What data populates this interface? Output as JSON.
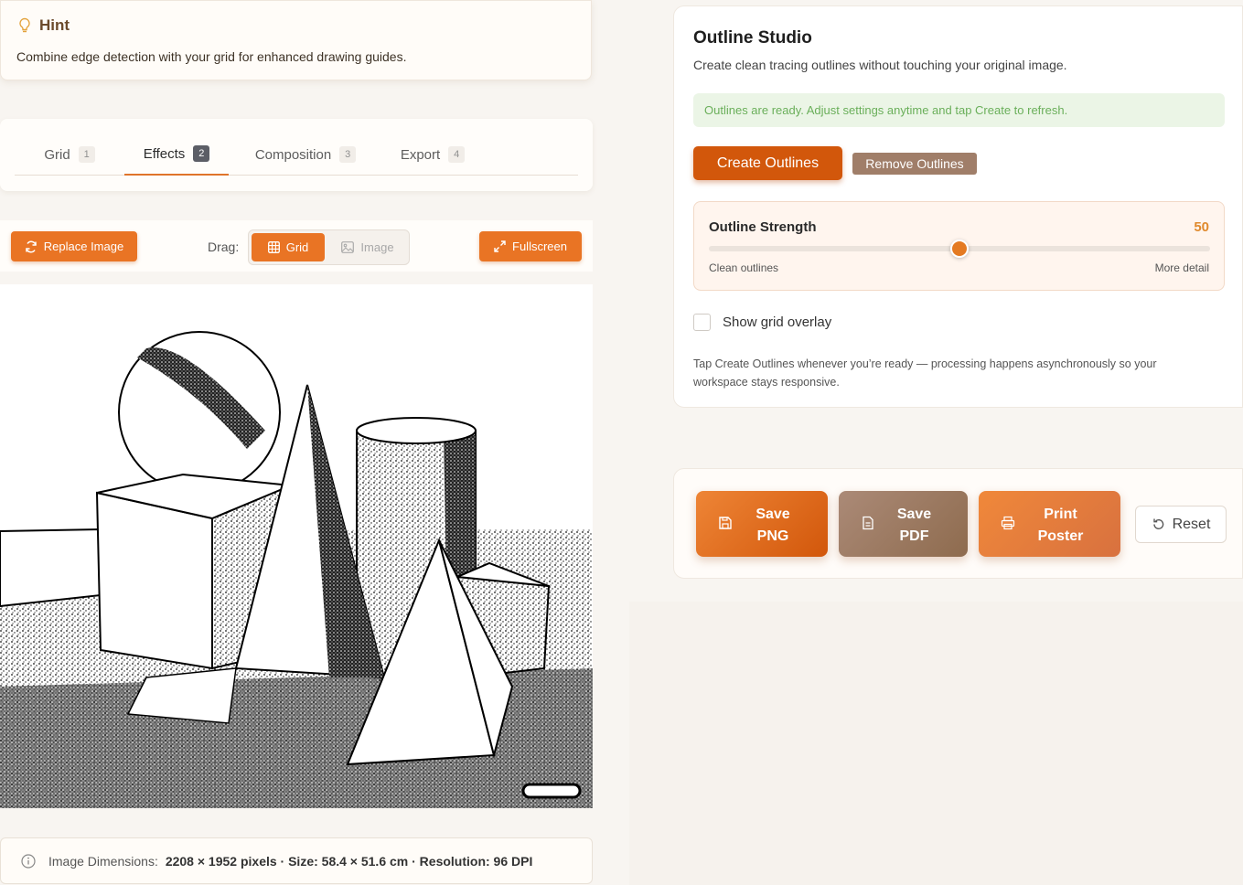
{
  "hint": {
    "title": "Hint",
    "text": "Combine edge detection with your grid for enhanced drawing guides."
  },
  "tabs": [
    {
      "label": "Grid",
      "num": "1"
    },
    {
      "label": "Effects",
      "num": "2"
    },
    {
      "label": "Composition",
      "num": "3"
    },
    {
      "label": "Export",
      "num": "4"
    }
  ],
  "active_tab": "Effects",
  "toolbar": {
    "replace_label": "Replace Image",
    "drag_label": "Drag:",
    "grid_label": "Grid",
    "image_label": "Image",
    "fullscreen_label": "Fullscreen"
  },
  "info": {
    "label": "Image Dimensions:",
    "value": "2208 × 1952 pixels · Size: 58.4 × 51.6 cm · Resolution: 96 DPI"
  },
  "studio": {
    "title": "Outline Studio",
    "subtitle": "Create clean tracing outlines without touching your original image.",
    "status": "Outlines are ready. Adjust settings anytime and tap Create to refresh.",
    "create_label": "Create Outlines",
    "remove_label": "Remove Outlines",
    "strength_label": "Outline Strength",
    "strength_value": "50",
    "strength_fraction": 0.5,
    "slider_min_label": "Clean outlines",
    "slider_max_label": "More detail",
    "grid_overlay_label": "Show grid overlay",
    "grid_overlay_checked": false,
    "note": "Tap Create Outlines whenever you’re ready — processing happens asynchronously so your workspace stays responsive."
  },
  "actions": {
    "save_png": {
      "line1": "Save",
      "line2": "PNG"
    },
    "save_pdf": {
      "line1": "Save",
      "line2": "PDF"
    },
    "print_poster": {
      "line1": "Print",
      "line2": "Poster"
    },
    "reset_label": "Reset"
  },
  "colors": {
    "accent": "#e97424",
    "create": "#d2570b",
    "remove": "#a07e69",
    "ready_text": "#6aaf5a"
  }
}
